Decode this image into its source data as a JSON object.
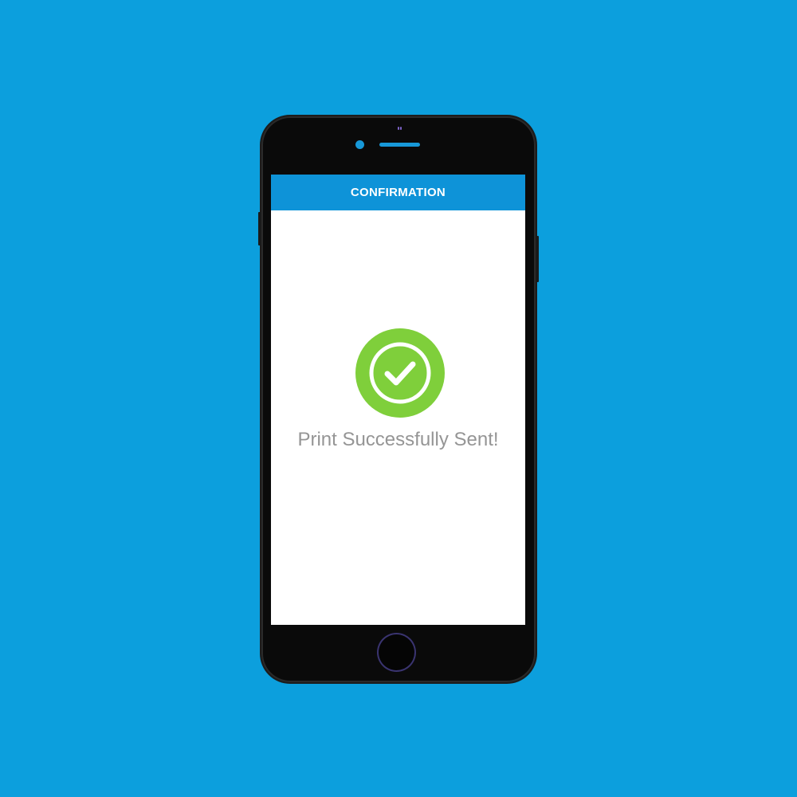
{
  "app": {
    "header": {
      "title": "CONFIRMATION"
    },
    "status": {
      "icon": "check-circle-icon",
      "message": "Print Successfully Sent!"
    }
  },
  "colors": {
    "background": "#0c9fdd",
    "header": "#0e93d8",
    "success": "#7fcf3b",
    "message_text": "#959595"
  }
}
